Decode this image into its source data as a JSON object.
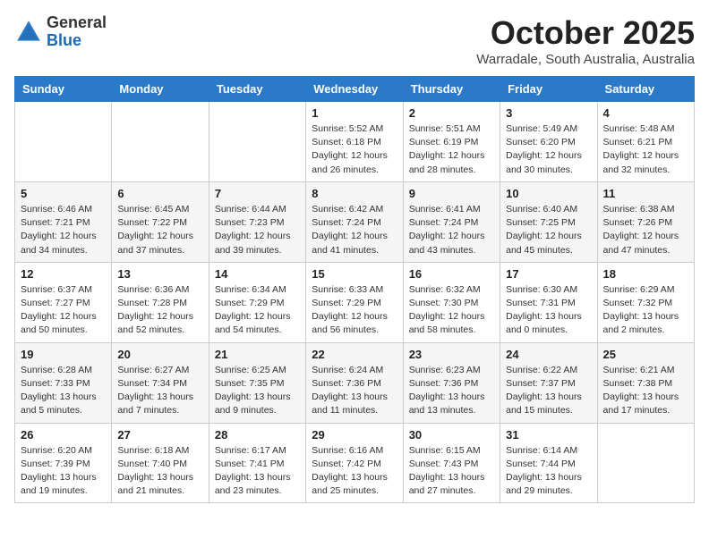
{
  "header": {
    "logo_general": "General",
    "logo_blue": "Blue",
    "month_title": "October 2025",
    "location": "Warradale, South Australia, Australia"
  },
  "weekdays": [
    "Sunday",
    "Monday",
    "Tuesday",
    "Wednesday",
    "Thursday",
    "Friday",
    "Saturday"
  ],
  "weeks": [
    [
      {
        "day": "",
        "sunrise": "",
        "sunset": "",
        "daylight": ""
      },
      {
        "day": "",
        "sunrise": "",
        "sunset": "",
        "daylight": ""
      },
      {
        "day": "",
        "sunrise": "",
        "sunset": "",
        "daylight": ""
      },
      {
        "day": "1",
        "sunrise": "Sunrise: 5:52 AM",
        "sunset": "Sunset: 6:18 PM",
        "daylight": "Daylight: 12 hours and 26 minutes."
      },
      {
        "day": "2",
        "sunrise": "Sunrise: 5:51 AM",
        "sunset": "Sunset: 6:19 PM",
        "daylight": "Daylight: 12 hours and 28 minutes."
      },
      {
        "day": "3",
        "sunrise": "Sunrise: 5:49 AM",
        "sunset": "Sunset: 6:20 PM",
        "daylight": "Daylight: 12 hours and 30 minutes."
      },
      {
        "day": "4",
        "sunrise": "Sunrise: 5:48 AM",
        "sunset": "Sunset: 6:21 PM",
        "daylight": "Daylight: 12 hours and 32 minutes."
      }
    ],
    [
      {
        "day": "5",
        "sunrise": "Sunrise: 6:46 AM",
        "sunset": "Sunset: 7:21 PM",
        "daylight": "Daylight: 12 hours and 34 minutes."
      },
      {
        "day": "6",
        "sunrise": "Sunrise: 6:45 AM",
        "sunset": "Sunset: 7:22 PM",
        "daylight": "Daylight: 12 hours and 37 minutes."
      },
      {
        "day": "7",
        "sunrise": "Sunrise: 6:44 AM",
        "sunset": "Sunset: 7:23 PM",
        "daylight": "Daylight: 12 hours and 39 minutes."
      },
      {
        "day": "8",
        "sunrise": "Sunrise: 6:42 AM",
        "sunset": "Sunset: 7:24 PM",
        "daylight": "Daylight: 12 hours and 41 minutes."
      },
      {
        "day": "9",
        "sunrise": "Sunrise: 6:41 AM",
        "sunset": "Sunset: 7:24 PM",
        "daylight": "Daylight: 12 hours and 43 minutes."
      },
      {
        "day": "10",
        "sunrise": "Sunrise: 6:40 AM",
        "sunset": "Sunset: 7:25 PM",
        "daylight": "Daylight: 12 hours and 45 minutes."
      },
      {
        "day": "11",
        "sunrise": "Sunrise: 6:38 AM",
        "sunset": "Sunset: 7:26 PM",
        "daylight": "Daylight: 12 hours and 47 minutes."
      }
    ],
    [
      {
        "day": "12",
        "sunrise": "Sunrise: 6:37 AM",
        "sunset": "Sunset: 7:27 PM",
        "daylight": "Daylight: 12 hours and 50 minutes."
      },
      {
        "day": "13",
        "sunrise": "Sunrise: 6:36 AM",
        "sunset": "Sunset: 7:28 PM",
        "daylight": "Daylight: 12 hours and 52 minutes."
      },
      {
        "day": "14",
        "sunrise": "Sunrise: 6:34 AM",
        "sunset": "Sunset: 7:29 PM",
        "daylight": "Daylight: 12 hours and 54 minutes."
      },
      {
        "day": "15",
        "sunrise": "Sunrise: 6:33 AM",
        "sunset": "Sunset: 7:29 PM",
        "daylight": "Daylight: 12 hours and 56 minutes."
      },
      {
        "day": "16",
        "sunrise": "Sunrise: 6:32 AM",
        "sunset": "Sunset: 7:30 PM",
        "daylight": "Daylight: 12 hours and 58 minutes."
      },
      {
        "day": "17",
        "sunrise": "Sunrise: 6:30 AM",
        "sunset": "Sunset: 7:31 PM",
        "daylight": "Daylight: 13 hours and 0 minutes."
      },
      {
        "day": "18",
        "sunrise": "Sunrise: 6:29 AM",
        "sunset": "Sunset: 7:32 PM",
        "daylight": "Daylight: 13 hours and 2 minutes."
      }
    ],
    [
      {
        "day": "19",
        "sunrise": "Sunrise: 6:28 AM",
        "sunset": "Sunset: 7:33 PM",
        "daylight": "Daylight: 13 hours and 5 minutes."
      },
      {
        "day": "20",
        "sunrise": "Sunrise: 6:27 AM",
        "sunset": "Sunset: 7:34 PM",
        "daylight": "Daylight: 13 hours and 7 minutes."
      },
      {
        "day": "21",
        "sunrise": "Sunrise: 6:25 AM",
        "sunset": "Sunset: 7:35 PM",
        "daylight": "Daylight: 13 hours and 9 minutes."
      },
      {
        "day": "22",
        "sunrise": "Sunrise: 6:24 AM",
        "sunset": "Sunset: 7:36 PM",
        "daylight": "Daylight: 13 hours and 11 minutes."
      },
      {
        "day": "23",
        "sunrise": "Sunrise: 6:23 AM",
        "sunset": "Sunset: 7:36 PM",
        "daylight": "Daylight: 13 hours and 13 minutes."
      },
      {
        "day": "24",
        "sunrise": "Sunrise: 6:22 AM",
        "sunset": "Sunset: 7:37 PM",
        "daylight": "Daylight: 13 hours and 15 minutes."
      },
      {
        "day": "25",
        "sunrise": "Sunrise: 6:21 AM",
        "sunset": "Sunset: 7:38 PM",
        "daylight": "Daylight: 13 hours and 17 minutes."
      }
    ],
    [
      {
        "day": "26",
        "sunrise": "Sunrise: 6:20 AM",
        "sunset": "Sunset: 7:39 PM",
        "daylight": "Daylight: 13 hours and 19 minutes."
      },
      {
        "day": "27",
        "sunrise": "Sunrise: 6:18 AM",
        "sunset": "Sunset: 7:40 PM",
        "daylight": "Daylight: 13 hours and 21 minutes."
      },
      {
        "day": "28",
        "sunrise": "Sunrise: 6:17 AM",
        "sunset": "Sunset: 7:41 PM",
        "daylight": "Daylight: 13 hours and 23 minutes."
      },
      {
        "day": "29",
        "sunrise": "Sunrise: 6:16 AM",
        "sunset": "Sunset: 7:42 PM",
        "daylight": "Daylight: 13 hours and 25 minutes."
      },
      {
        "day": "30",
        "sunrise": "Sunrise: 6:15 AM",
        "sunset": "Sunset: 7:43 PM",
        "daylight": "Daylight: 13 hours and 27 minutes."
      },
      {
        "day": "31",
        "sunrise": "Sunrise: 6:14 AM",
        "sunset": "Sunset: 7:44 PM",
        "daylight": "Daylight: 13 hours and 29 minutes."
      },
      {
        "day": "",
        "sunrise": "",
        "sunset": "",
        "daylight": ""
      }
    ]
  ]
}
